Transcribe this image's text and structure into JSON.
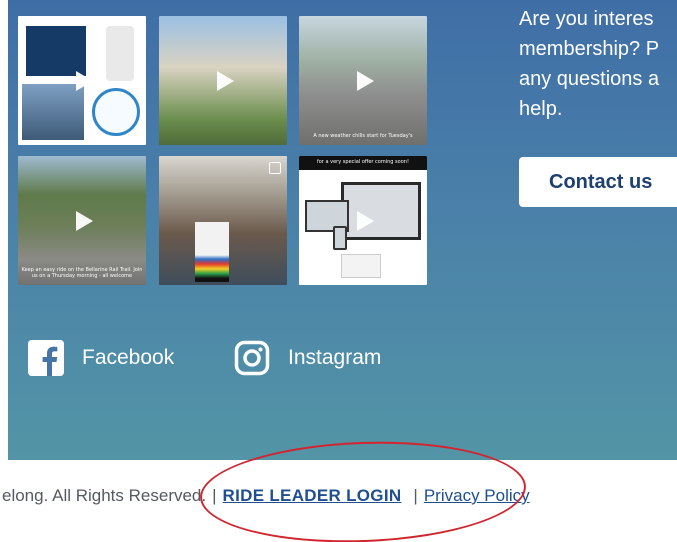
{
  "promo": {
    "lines": [
      "Are you interes",
      "membership? P",
      "any questions a",
      "help."
    ],
    "contact_label": "Contact us"
  },
  "instagram": {
    "tiles": [
      {
        "caption": ""
      },
      {
        "caption": ""
      },
      {
        "caption": "A new weather chills start for Tuesday's"
      },
      {
        "caption": "Keep an easy ride on the Bellarine Rail Trail. Join us on a Thursday morning - all welcome"
      },
      {
        "caption": ""
      },
      {
        "caption": "for a very special offer coming soon!"
      }
    ]
  },
  "social": {
    "facebook_label": "Facebook",
    "instagram_label": "Instagram"
  },
  "footer": {
    "copyright": "elong. All Rights Reserved.",
    "separator": "|",
    "ride_leader_login": "RIDE LEADER LOGIN",
    "privacy_policy": "Privacy Policy"
  },
  "colors": {
    "gradient_top": "#3f6ea6",
    "gradient_bottom": "#5395a6",
    "button_text": "#1d3f72",
    "link": "#1f4f8e",
    "annotation": "#d1252f"
  }
}
